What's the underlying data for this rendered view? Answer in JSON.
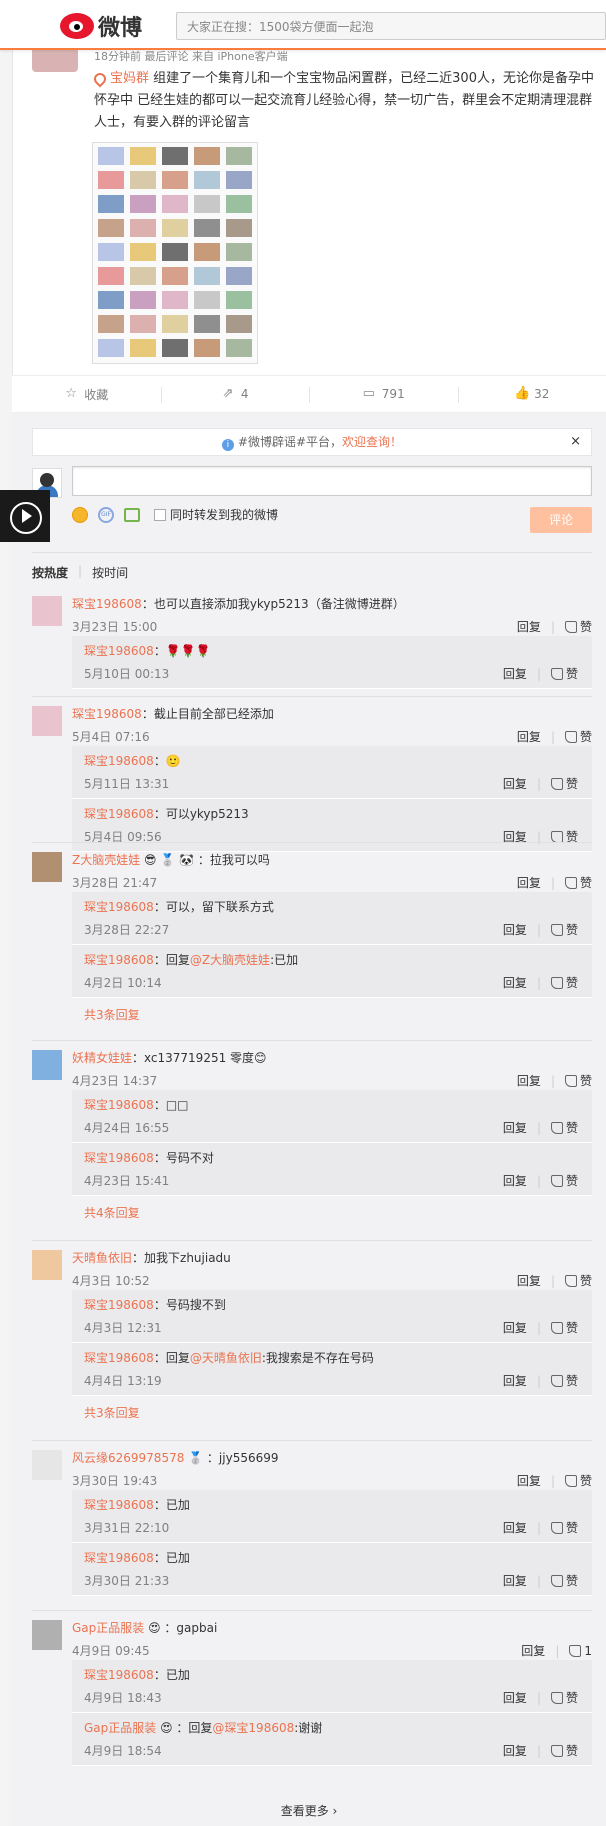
{
  "topbar": {
    "logo_text": "微博",
    "search_placeholder": "大家正在搜：1500袋方便面一起泡"
  },
  "post": {
    "meta": "18分钟前 最后评论 来自 iPhone客户端",
    "tag": "宝妈群",
    "body": "组建了一个集育儿和一个宝宝物品闲置群，已经二近300人，无论你是备孕中 怀孕中 已经生娃的都可以一起交流育儿经验心得，禁一切广告，群里会不定期清理混群人士，有要入群的评论留言"
  },
  "actions": {
    "favorite": "收藏",
    "repost": "4",
    "comment": "791",
    "like": "32"
  },
  "notice": {
    "prefix": "#微博辟谣#平台，",
    "highlight": "欢迎查询！",
    "close": "×",
    "info_icon": "i"
  },
  "composer": {
    "forward_label": "同时转发到我的微博",
    "submit": "评论",
    "gif": "GIF"
  },
  "sort": {
    "hot": "按热度",
    "time": "按时间",
    "sep": "|"
  },
  "labels": {
    "reply": "回复",
    "like": "赞",
    "sep": "|",
    "more_all": "查看更多 ›"
  },
  "threads": [
    {
      "user": "琛宝198608",
      "text": "：也可以直接添加我ykyp5213（备注微博进群）",
      "time": "3月23日 15:00",
      "replies": [
        {
          "user": "琛宝198608",
          "text": "：🌹🌹🌹",
          "time": "5月10日 00:13"
        }
      ]
    },
    {
      "user": "琛宝198608",
      "text": "：截止目前全部已经添加",
      "time": "5月4日 07:16",
      "replies": [
        {
          "user": "琛宝198608",
          "text": "：🙂",
          "time": "5月11日 13:31"
        },
        {
          "user": "琛宝198608",
          "text": "：可以ykyp5213",
          "time": "5月4日 09:56"
        }
      ]
    },
    {
      "user": "Z大脑壳娃娃",
      "text": " 😎 🥈 🐼 ：拉我可以吗",
      "time": "3月28日 21:47",
      "replies": [
        {
          "user": "琛宝198608",
          "text": "：可以，留下联系方式",
          "time": "3月28日 22:27"
        },
        {
          "user": "琛宝198608",
          "text": "：回复",
          "mention": "@Z大脑壳娃娃",
          "tail": ":已加",
          "time": "4月2日 10:14"
        }
      ],
      "more": "共3条回复"
    },
    {
      "user": "妖精女娃娃",
      "text": "：xc137719251 零度😊",
      "time": "4月23日 14:37",
      "replies": [
        {
          "user": "琛宝198608",
          "text": "：□□",
          "time": "4月24日 16:55"
        },
        {
          "user": "琛宝198608",
          "text": "：号码不对",
          "time": "4月23日 15:41"
        }
      ],
      "more": "共4条回复"
    },
    {
      "user": "天晴鱼依旧",
      "text": "：加我下zhujiadu",
      "time": "4月3日 10:52",
      "replies": [
        {
          "user": "琛宝198608",
          "text": "：号码搜不到",
          "time": "4月3日 12:31"
        },
        {
          "user": "琛宝198608",
          "text": "：回复",
          "mention": "@天晴鱼依旧",
          "tail": ":我搜索是不存在号码",
          "time": "4月4日 13:19"
        }
      ],
      "more": "共3条回复"
    },
    {
      "user": "风云缘6269978578",
      "text": " 🥈 ：jjy556699",
      "time": "3月30日 19:43",
      "replies": [
        {
          "user": "琛宝198608",
          "text": "：已加",
          "time": "3月31日 22:10"
        },
        {
          "user": "琛宝198608",
          "text": "：已加",
          "time": "3月30日 21:33"
        }
      ]
    },
    {
      "user": "Gap正品服装",
      "text": " 😍 ：gapbai",
      "time": "4月9日 09:45",
      "likes": "1",
      "replies": [
        {
          "user": "琛宝198608",
          "text": "：已加",
          "time": "4月9日 18:43"
        },
        {
          "user": "Gap正品服装",
          "text": " 😍 ：回复",
          "mention": "@琛宝198608",
          "tail": ":谢谢",
          "time": "4月9日 18:54"
        }
      ]
    }
  ]
}
